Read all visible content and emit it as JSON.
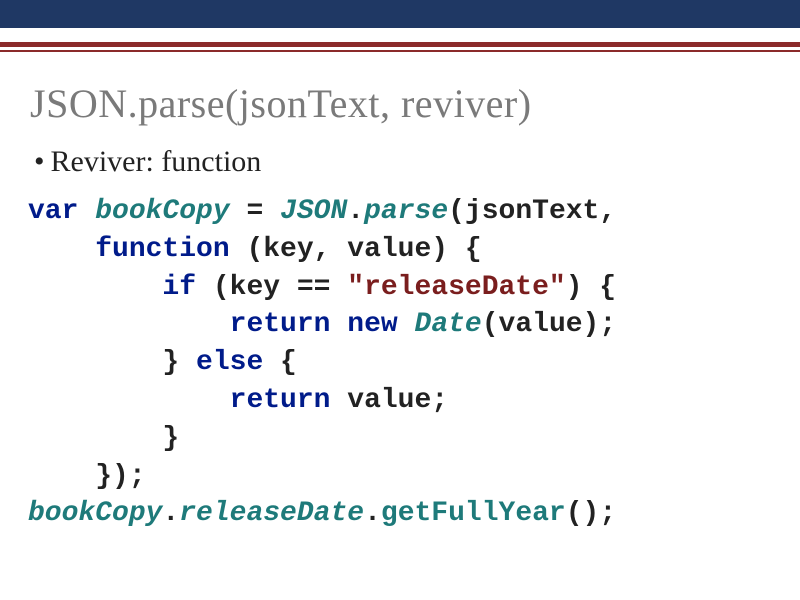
{
  "slide": {
    "title": "JSON.parse(jsonText, reviver)",
    "bullet": "Reviver: function"
  },
  "code": {
    "kw_var": "var",
    "id_bookCopy": "bookCopy",
    "eq": " = ",
    "type_json": "JSON",
    "dot1": ".",
    "id_parse": "parse",
    "open1": "(jsonText,",
    "line2_indent": "    ",
    "kw_function": "function",
    "params": " (key, value) {",
    "line3_indent": "        ",
    "kw_if": "if",
    "cond_open": " (key == ",
    "str_releaseDate": "\"releaseDate\"",
    "cond_close": ") {",
    "line4_indent": "            ",
    "kw_return1": "return",
    "sp1": " ",
    "kw_new": "new",
    "sp2": " ",
    "type_date": "Date",
    "date_args": "(value);",
    "line5_indent": "        ",
    "brace_close1": "} ",
    "kw_else": "else",
    "brace_open2": " {",
    "line6_indent": "            ",
    "kw_return2": "return",
    "ret_val": " value;",
    "line7_indent": "        ",
    "brace_close2": "}",
    "line8_indent": "    ",
    "closing": "});",
    "id_bookCopy2": "bookCopy",
    "dot2": ".",
    "id_releaseDate": "releaseDate",
    "dot3": ".",
    "mem_getFullYear": "getFullYear",
    "call_end": "();"
  }
}
